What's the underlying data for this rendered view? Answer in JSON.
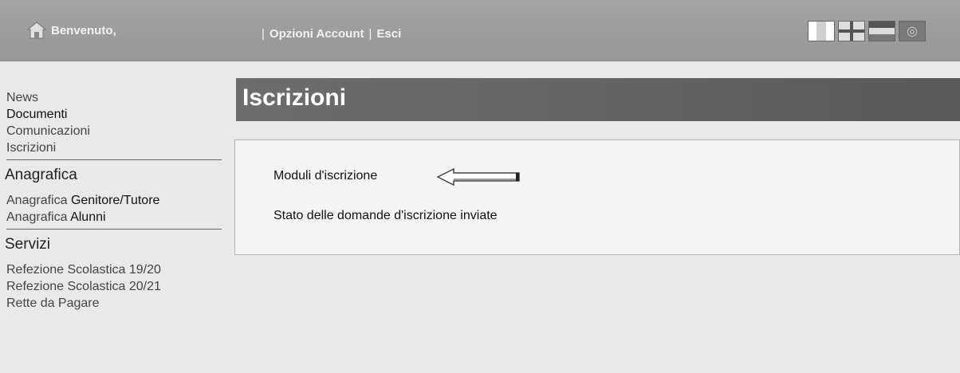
{
  "header": {
    "welcome": "Benvenuto,",
    "sep1": "|",
    "account_options": "Opzioni Account",
    "sep2": "|",
    "logout": "Esci",
    "language_flags": [
      "flag-italy-icon",
      "flag-uk-icon",
      "flag-germany-icon",
      "flag-other-icon"
    ]
  },
  "sidebar": {
    "top_links": [
      "News",
      "Documenti",
      "Comunicazioni",
      "Iscrizioni"
    ],
    "anagrafica": {
      "heading": "Anagrafica",
      "genitore_prefix": "Anagrafica",
      "genitore_suffix": "Genitore/Tutore",
      "alunni_prefix": "Anagrafica",
      "alunni_suffix": "Alunni"
    },
    "servizi": {
      "heading": "Servizi",
      "items": [
        "Refezione Scolastica 19/20",
        "Refezione Scolastica 20/21",
        "Rette da Pagare"
      ]
    }
  },
  "main": {
    "title": "Iscrizioni",
    "items": [
      "Moduli d'iscrizione",
      "Stato delle domande d'iscrizione inviate"
    ]
  }
}
